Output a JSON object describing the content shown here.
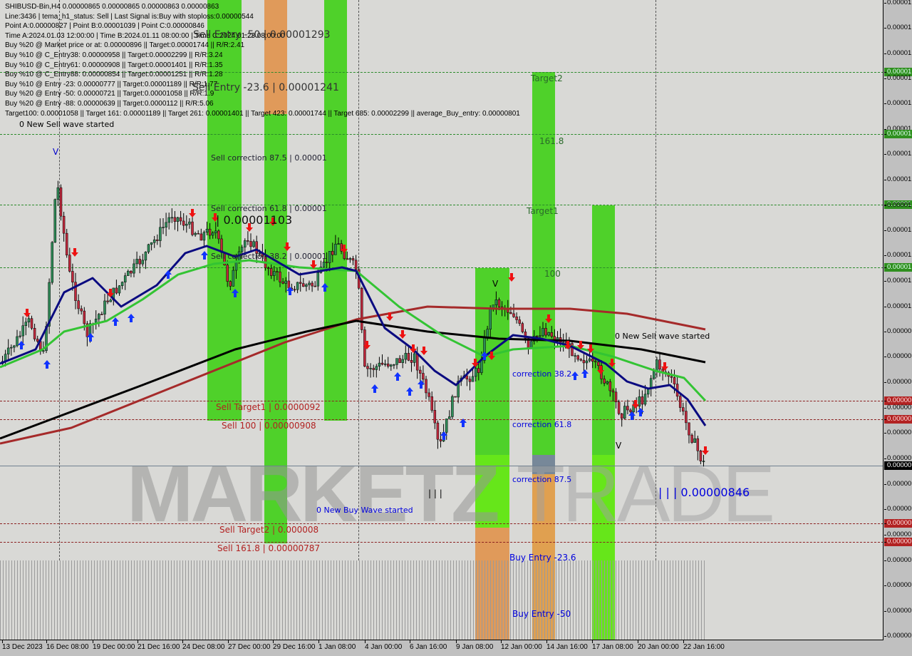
{
  "info_lines": [
    "SHIBUSD-Bin,H4  0.00000865 0.00000865 0.00000863 0.00000863",
    "Line:3436 | tema_h1_status: Sell | Last Signal is:Buy with stoploss:0.00000544",
    "Point A:0.00000827 | Point B:0.00001039 | Point C:0.00000846",
    "Time A:2024.01.03 12:00:00 | Time B:2024.01.11 08:00:00 | Time C:2024.01.23 08:00:00",
    "Buy %20 @ Market price or at: 0.00000896 || Target:0.00001744 || R/R:2.41",
    "Buy %10 @ C_Entry38: 0.00000958 || Target:0.00002299 || R/R:3.24",
    "Buy %10 @ C_Entry61: 0.00000908 || Target:0.00001401 || R/R:1.35",
    "Buy %10 @ C_Entry88: 0.00000854 || Target:0.00001251 || R/R:1.28",
    "Buy %10 @ Entry -23: 0.00000777 || Target:0.00001189 || R/R:1.77",
    "Buy %20 @ Entry -50: 0.00000721 || Target:0.00001058 || R/R:1.9",
    "Buy %20 @ Entry -88: 0.00000639 || Target:0.0000112 || R/R:5.06",
    "Target100: 0.00001058 || Target 161: 0.00001189 || Target 261: 0.00001401 || Target 423: 0.00001744 || Target 685: 0.00002299 || average_Buy_entry: 0.00000801"
  ],
  "labels": {
    "sell_wave_1": "0 New Sell wave started",
    "sell_entry_50": "Sell Entry -50 | 0.00001293",
    "sell_entry_236": "Sell Entry -23.6 | 0.00001241",
    "sell_corr_875": "Sell correction 87.5 | 0.00001",
    "sell_corr_618": "Sell correction 61.8 | 0.00001",
    "point_b": "| 0.00001103",
    "sell_corr_382": "Sell correction 38.2 | 0.00001",
    "target2": "Target2",
    "l1618": "161.8",
    "target1": "Target1",
    "l100": "100",
    "sell_wave_2": "0 New Sell wave started",
    "corr_382": "correction 38.2",
    "corr_618": "correction 61.8",
    "corr_875": "correction 87.5",
    "point_c": "| | | 0.00000846",
    "point_a": "| | |",
    "buy_wave": "0 New Buy Wave started",
    "sell_target1": "Sell Target1 | 0.0000092",
    "sell_100": "Sell 100 | 0.00000908",
    "sell_target2": "Sell Target2 | 0.000008",
    "sell_1618": "Sell 161.8 | 0.00000787",
    "buy_entry_236": "Buy Entry -23.6",
    "buy_entry_50": "Buy Entry -50",
    "v1": "V",
    "v2": "V",
    "v3": "V"
  },
  "watermark": {
    "main": "MARKETZ",
    "tail": "TRADE"
  },
  "price_axis": [
    "0.00001",
    "0.00001",
    "0.00001",
    "0.00001",
    "0.00001",
    "0.00001",
    "0.00001",
    "0.00001",
    "0.00001",
    "0.00001",
    "0.00001",
    "0.00001",
    "0.00001",
    "0.00001",
    "0.00001",
    "0.00001",
    "0.00001",
    "0.00000",
    "0.00000",
    "0.00000",
    "0.00000",
    "0.00000",
    "0.00000",
    "0.00000",
    "0.00000",
    "0.00000",
    "0.00000",
    "0.00000",
    "0.00000",
    "0.00000",
    "0.00000",
    "0.00000",
    "0.00000",
    "0.00000",
    "0.00000",
    "0.00000"
  ],
  "time_axis": [
    "13 Dec 2023",
    "16 Dec 08:00",
    "19 Dec 00:00",
    "21 Dec 16:00",
    "24 Dec 08:00",
    "27 Dec 00:00",
    "29 Dec 16:00",
    "1 Jan 08:00",
    "4 Jan 00:00",
    "6 Jan 16:00",
    "9 Jan 08:00",
    "12 Jan 00:00",
    "14 Jan 16:00",
    "17 Jan 08:00",
    "20 Jan 00:00",
    "22 Jan 16:00"
  ],
  "colors": {
    "chart_bg": "#d9d9d6",
    "band_green": "#4fd12a",
    "band_lime": "#66e61a",
    "band_orange": "#e09a5a",
    "ma_navy": "#0a0a80",
    "ma_green": "#33c433",
    "ma_black": "#000000",
    "ma_red": "#a52a2a",
    "bull": "#2e8b57",
    "bear": "#c0283c"
  }
}
